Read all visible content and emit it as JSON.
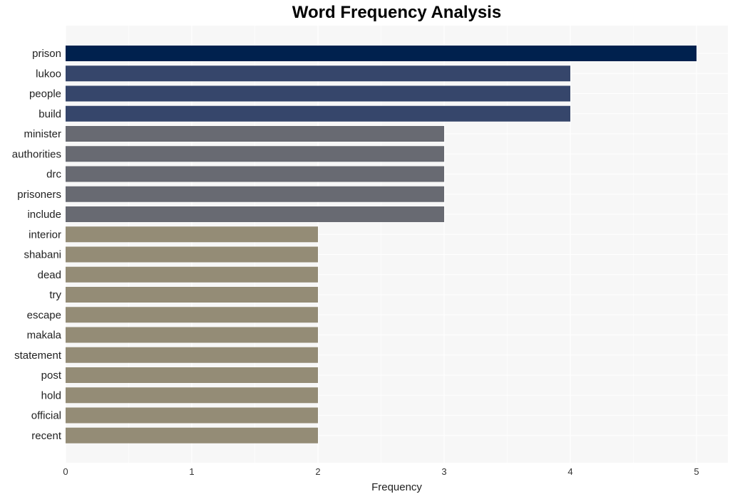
{
  "chart_data": {
    "type": "bar",
    "orientation": "horizontal",
    "title": "Word Frequency Analysis",
    "xlabel": "Frequency",
    "ylabel": "",
    "xlim": [
      0,
      5.25
    ],
    "xticks": [
      0,
      1,
      2,
      3,
      4,
      5
    ],
    "grid": true,
    "legend": "none",
    "categories": [
      "prison",
      "lukoo",
      "people",
      "build",
      "minister",
      "authorities",
      "drc",
      "prisoners",
      "include",
      "interior",
      "shabani",
      "dead",
      "try",
      "escape",
      "makala",
      "statement",
      "post",
      "hold",
      "official",
      "recent"
    ],
    "values": [
      5,
      4,
      4,
      4,
      3,
      3,
      3,
      3,
      3,
      2,
      2,
      2,
      2,
      2,
      2,
      2,
      2,
      2,
      2,
      2
    ],
    "color_scale": {
      "5": "#00214e",
      "4": "#36466b",
      "3": "#686a72",
      "2": "#948c76"
    }
  },
  "colors": {
    "plot_background": "#f7f7f7",
    "gridline": "#ffffff"
  }
}
